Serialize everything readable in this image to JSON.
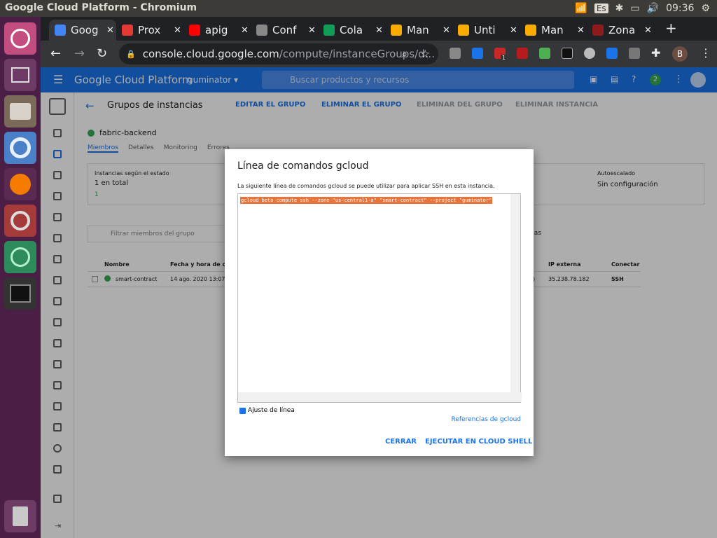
{
  "window": {
    "title": "Google Cloud Platform - Chromium",
    "lang": "Es",
    "clock": "09:36"
  },
  "tabs": [
    {
      "label": "Goog"
    },
    {
      "label": "Prox"
    },
    {
      "label": "apig"
    },
    {
      "label": "Conf"
    },
    {
      "label": "Cola"
    },
    {
      "label": "Man"
    },
    {
      "label": "Unti"
    },
    {
      "label": "Man"
    },
    {
      "label": "Zona"
    }
  ],
  "colors": {
    "tab_favicons": [
      "#4285f4",
      "#e53935",
      "#ff0000",
      "#888888",
      "#0f9d58",
      "#f9ab00",
      "#f9ab00",
      "#f9ab00",
      "#8e1b1b"
    ]
  },
  "omnibox": {
    "host": "console.cloud.google.com",
    "path": "/compute/instanceGroups/d..."
  },
  "ext": {
    "abp_count": "1",
    "profile": "B"
  },
  "gcp": {
    "brand": "Google Cloud Platform",
    "project": "guminator",
    "search_placeholder": "Buscar productos y recursos",
    "badge": "2"
  },
  "page": {
    "back": "←",
    "title": "Grupos de instancias",
    "edit": "EDITAR EL GRUPO",
    "delete_group": "ELIMINAR EL GRUPO",
    "delete_from_group": "ELIMINAR DEL GRUPO",
    "delete_instance": "ELIMINAR INSTANCIA",
    "group_name": "fabric-backend",
    "tabs": [
      "Miembros",
      "Detalles",
      "Monitoring",
      "Errores"
    ],
    "state_label": "Instancias según el estado",
    "state_total": "1 en total",
    "state_ok": "1",
    "autoscale_label": "Autoescalado",
    "autoscale_value": "Sin configuración",
    "filter": "Filtrar miembros del grupo",
    "columns_btn": "nas",
    "col_name": "Nombre",
    "col_date": "Fecha y hora de creac",
    "col_ip": "IP externa",
    "col_connect": "Conectar",
    "row_name": "smart-contract",
    "row_date": "14 ago. 2020 13:07",
    "row_ip": "35.238.78.182",
    "row_ssh": "SSH",
    "row_partial": ")"
  },
  "dialog": {
    "title": "Línea de comandos gcloud",
    "description": "La siguiente línea de comandos gcloud se puede utilizar para aplicar SSH en esta instancia.",
    "command": "gcloud beta compute ssh --zone \"us-central1-a\" \"smart-contract\" --project \"guminator\"",
    "wrap_label": "Ajuste de línea",
    "wrap_checked": true,
    "refs": "Referencias de gcloud",
    "close": "CERRAR",
    "run": "EJECUTAR EN CLOUD SHELL"
  }
}
